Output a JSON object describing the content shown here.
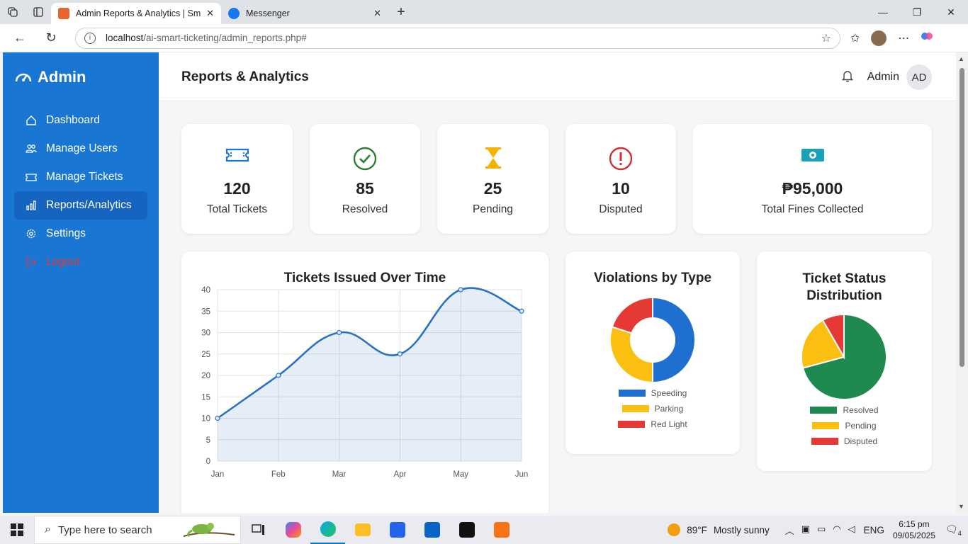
{
  "browser": {
    "tabs": [
      {
        "title": "Admin Reports & Analytics | Smar",
        "favicon_color": "#e8652f",
        "active": true
      },
      {
        "title": "Messenger",
        "favicon_color": "#1877f2",
        "active": false
      }
    ],
    "url_host": "localhost",
    "url_path": "/ai-smart-ticketing/admin_reports.php#"
  },
  "sidebar": {
    "brand": "Admin",
    "items": [
      {
        "label": "Dashboard",
        "icon": "home-icon"
      },
      {
        "label": "Manage Users",
        "icon": "users-icon"
      },
      {
        "label": "Manage Tickets",
        "icon": "ticket-icon"
      },
      {
        "label": "Reports/Analytics",
        "icon": "bar-chart-icon"
      },
      {
        "label": "Settings",
        "icon": "gear-icon"
      },
      {
        "label": "Logout",
        "icon": "logout-icon"
      }
    ],
    "active_index": 3
  },
  "header": {
    "title": "Reports & Analytics",
    "user_name": "Admin",
    "avatar_initials": "AD"
  },
  "stats": [
    {
      "value": "120",
      "label": "Total Tickets",
      "icon": "ticket-icon",
      "color": "#1976d2"
    },
    {
      "value": "85",
      "label": "Resolved",
      "icon": "check-circle-icon",
      "color": "#2e7d32"
    },
    {
      "value": "25",
      "label": "Pending",
      "icon": "hourglass-icon",
      "color": "#f5b301"
    },
    {
      "value": "10",
      "label": "Disputed",
      "icon": "exclamation-circle-icon",
      "color": "#d32f2f"
    },
    {
      "value": "₱95,000",
      "label": "Total Fines Collected",
      "icon": "money-icon",
      "color": "#17a2b8"
    }
  ],
  "chart_data": [
    {
      "type": "line",
      "title": "Tickets Issued Over Time",
      "categories": [
        "Jan",
        "Feb",
        "Mar",
        "Apr",
        "May",
        "Jun"
      ],
      "series": [
        {
          "values": [
            10,
            20,
            30,
            25,
            40,
            35
          ]
        }
      ],
      "ylim": [
        0,
        40
      ],
      "yticks": [
        0,
        5,
        10,
        15,
        20,
        25,
        30,
        35,
        40
      ],
      "grid": true,
      "fill": true,
      "color": "#2a72c1"
    },
    {
      "type": "pie",
      "donut": true,
      "title": "Violations by Type",
      "labels": [
        "Speeding",
        "Parking",
        "Red Light"
      ],
      "values": [
        50,
        30,
        20
      ],
      "colors": [
        "#1f6fd0",
        "#fbbf12",
        "#e53935"
      ],
      "legend": "bottom"
    },
    {
      "type": "pie",
      "donut": false,
      "title": "Ticket Status Distribution",
      "labels": [
        "Resolved",
        "Pending",
        "Disputed"
      ],
      "values": [
        85,
        25,
        10
      ],
      "colors": [
        "#1e8a4f",
        "#fbbf12",
        "#e53935"
      ],
      "legend": "bottom"
    }
  ],
  "taskbar": {
    "search_placeholder": "Type here to search",
    "weather_temp": "89°F",
    "weather_desc": "Mostly sunny",
    "lang": "ENG",
    "time": "6:15 pm",
    "date": "09/05/2025",
    "notifications": "4"
  }
}
